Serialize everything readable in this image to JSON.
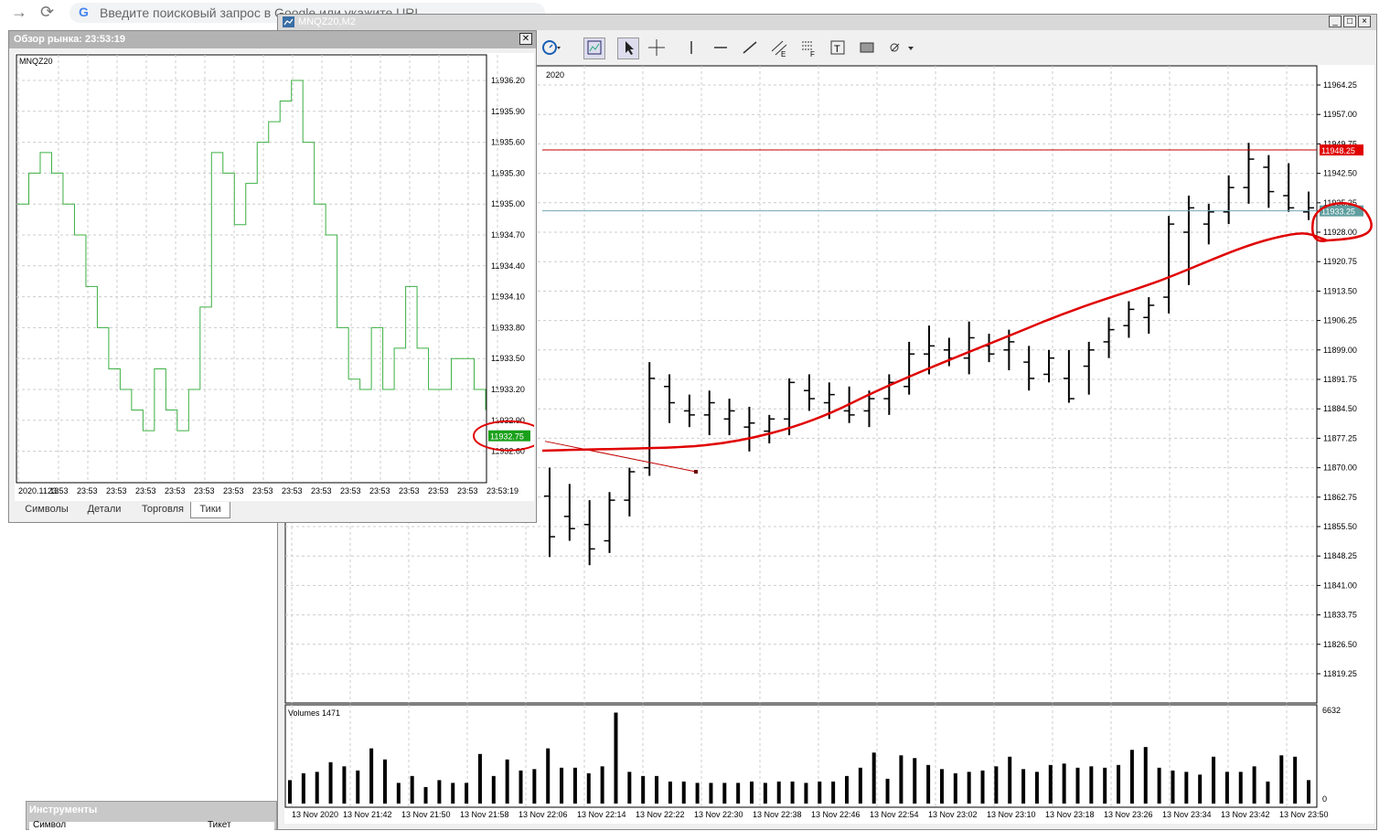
{
  "browser": {
    "omnibox_placeholder": "Введите поисковый запрос в Google или укажите URL",
    "google_letter": "G"
  },
  "mt_window": {
    "title": "MNQZ20,M2",
    "buttons": {
      "minimize": "_",
      "maximize": "□",
      "close": "×"
    }
  },
  "main_chart": {
    "price_levels": [
      "11964.25",
      "11957.00",
      "11949.75",
      "11942.50",
      "11935.25",
      "11928.00",
      "11920.75",
      "11913.50",
      "11906.25",
      "11899.00",
      "11891.75",
      "11884.50",
      "11877.25",
      "11870.00",
      "11862.75",
      "11855.50",
      "11848.25",
      "11841.00",
      "11833.75",
      "11826.50",
      "11819.25"
    ],
    "ask_badge": "11948.25",
    "bid_badge": "11933.25",
    "year_label": "2020",
    "time_labels": [
      "13 Nov 2020",
      "13 Nov 21:42",
      "13 Nov 21:50",
      "13 Nov 21:58",
      "13 Nov 22:06",
      "13 Nov 22:14",
      "13 Nov 22:22",
      "13 Nov 22:30",
      "13 Nov 22:38",
      "13 Nov 22:46",
      "13 Nov 22:54",
      "13 Nov 23:02",
      "13 Nov 23:10",
      "13 Nov 23:18",
      "13 Nov 23:26",
      "13 Nov 23:34",
      "13 Nov 23:42",
      "13 Nov 23:50"
    ],
    "volumes_label": "Volumes 1471",
    "volume_scale_max": "6632",
    "volume_scale_min": "0",
    "colors": {
      "bars": "#000000",
      "ask_line": "#c00000",
      "bid_line": "#6fa8b8",
      "annotation": "#e00000",
      "ask_badge": "#e00000",
      "bid_badge": "#5f9ea0"
    }
  },
  "market_watch": {
    "title": "Обзор рынка: 23:53:19",
    "symbol": "MNQZ20",
    "price_levels": [
      "11936.20",
      "11935.90",
      "11935.60",
      "11935.30",
      "11935.00",
      "11934.70",
      "11934.40",
      "11934.10",
      "11933.80",
      "11933.50",
      "11933.20",
      "11932.90",
      "11932.60"
    ],
    "current_price_badge": "11932.75",
    "time_labels": [
      "2020.11.13",
      "23:53",
      "23:53",
      "23:53",
      "23:53",
      "23:53",
      "23:53",
      "23:53",
      "23:53",
      "23:53",
      "23:53",
      "23:53",
      "23:53",
      "23:53",
      "23:53",
      "23:53",
      "23:53:19"
    ],
    "tabs": [
      "Символы",
      "Детали",
      "Торговля",
      "Тики"
    ],
    "active_tab": "Тики",
    "colors": {
      "tick_line": "#3cb043",
      "price_badge": "#1aa01a"
    }
  },
  "instruments": {
    "title": "Инструменты",
    "col1": "Символ",
    "col2": "Тикет"
  }
}
